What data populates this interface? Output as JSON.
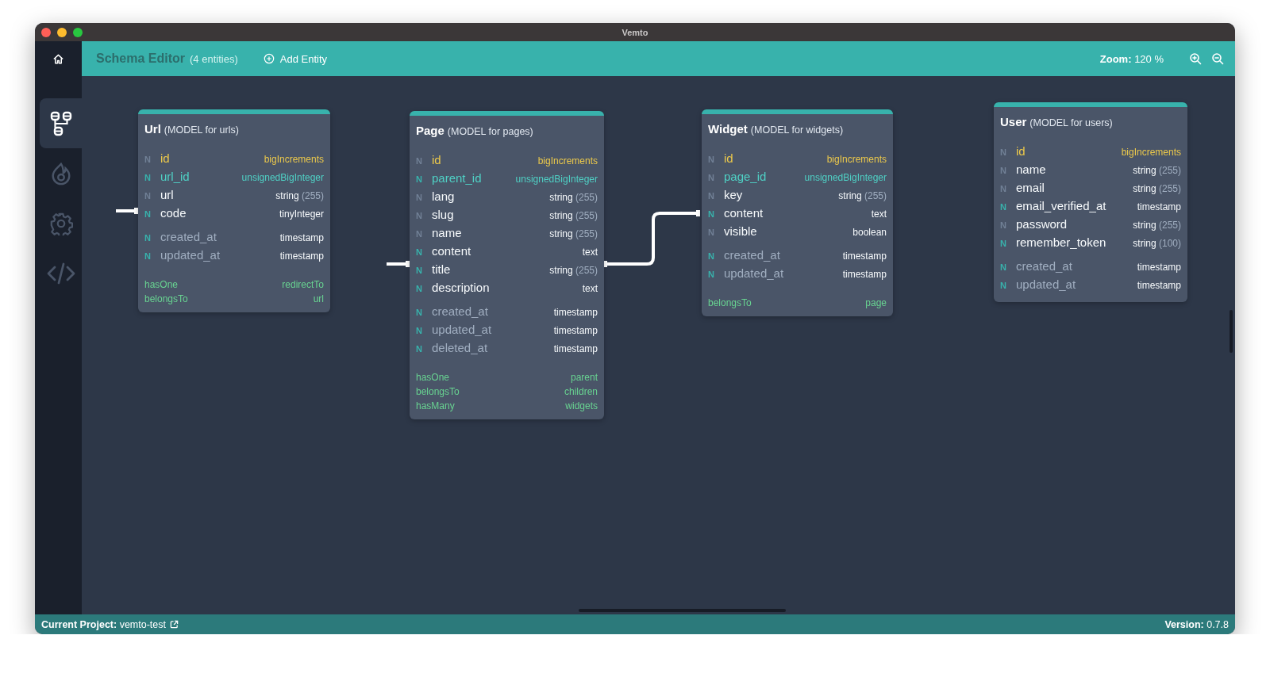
{
  "window": {
    "title": "Vemto"
  },
  "sidebar": {
    "items": [
      {
        "kind": "schema",
        "selected": true
      },
      {
        "kind": "fire",
        "selected": false
      },
      {
        "kind": "settings",
        "selected": false
      },
      {
        "kind": "code",
        "selected": false
      }
    ]
  },
  "header": {
    "title": "Schema Editor",
    "count": "(4 entities)",
    "add_button": "Add Entity",
    "zoom_label": "Zoom:",
    "zoom_value": "120 %"
  },
  "entities": [
    {
      "name": "Url",
      "subtitle": "(MODEL for urls)",
      "fields": [
        {
          "flag": "N",
          "nullable": false,
          "name": "id",
          "kind": "primary",
          "type": "bigIncrements"
        },
        {
          "flag": "N",
          "nullable": true,
          "name": "url_id",
          "kind": "foreign",
          "type": "unsignedBigInteger"
        },
        {
          "flag": "N",
          "nullable": false,
          "name": "url",
          "kind": "column",
          "type": "string",
          "length": "(255)"
        },
        {
          "flag": "N",
          "nullable": true,
          "name": "code",
          "kind": "column",
          "type": "tinyInteger"
        },
        {
          "flag": "N",
          "nullable": true,
          "name": "created_at",
          "kind": "timestamp",
          "type": "timestamp"
        },
        {
          "flag": "N",
          "nullable": true,
          "name": "updated_at",
          "kind": "timestamp",
          "type": "timestamp"
        }
      ],
      "relations": [
        {
          "type": "hasOne",
          "name": "redirectTo"
        },
        {
          "type": "belongsTo",
          "name": "url"
        }
      ]
    },
    {
      "name": "Page",
      "subtitle": "(MODEL for pages)",
      "fields": [
        {
          "flag": "N",
          "nullable": false,
          "name": "id",
          "kind": "primary",
          "type": "bigIncrements"
        },
        {
          "flag": "N",
          "nullable": true,
          "name": "parent_id",
          "kind": "foreign",
          "type": "unsignedBigInteger"
        },
        {
          "flag": "N",
          "nullable": false,
          "name": "lang",
          "kind": "column",
          "type": "string",
          "length": "(255)"
        },
        {
          "flag": "N",
          "nullable": false,
          "name": "slug",
          "kind": "column",
          "type": "string",
          "length": "(255)"
        },
        {
          "flag": "N",
          "nullable": false,
          "name": "name",
          "kind": "column",
          "type": "string",
          "length": "(255)"
        },
        {
          "flag": "N",
          "nullable": true,
          "name": "content",
          "kind": "column",
          "type": "text"
        },
        {
          "flag": "N",
          "nullable": true,
          "name": "title",
          "kind": "column",
          "type": "string",
          "length": "(255)"
        },
        {
          "flag": "N",
          "nullable": true,
          "name": "description",
          "kind": "column",
          "type": "text"
        },
        {
          "flag": "N",
          "nullable": true,
          "name": "created_at",
          "kind": "timestamp",
          "type": "timestamp"
        },
        {
          "flag": "N",
          "nullable": true,
          "name": "updated_at",
          "kind": "timestamp",
          "type": "timestamp"
        },
        {
          "flag": "N",
          "nullable": true,
          "name": "deleted_at",
          "kind": "timestamp",
          "type": "timestamp"
        }
      ],
      "relations": [
        {
          "type": "hasOne",
          "name": "parent"
        },
        {
          "type": "belongsTo",
          "name": "children"
        },
        {
          "type": "hasMany",
          "name": "widgets"
        }
      ]
    },
    {
      "name": "Widget",
      "subtitle": "(MODEL for widgets)",
      "fields": [
        {
          "flag": "N",
          "nullable": false,
          "name": "id",
          "kind": "primary",
          "type": "bigIncrements"
        },
        {
          "flag": "N",
          "nullable": false,
          "name": "page_id",
          "kind": "foreign",
          "type": "unsignedBigInteger"
        },
        {
          "flag": "N",
          "nullable": false,
          "name": "key",
          "kind": "column",
          "type": "string",
          "length": "(255)"
        },
        {
          "flag": "N",
          "nullable": true,
          "name": "content",
          "kind": "column",
          "type": "text"
        },
        {
          "flag": "N",
          "nullable": false,
          "name": "visible",
          "kind": "column",
          "type": "boolean"
        },
        {
          "flag": "N",
          "nullable": true,
          "name": "created_at",
          "kind": "timestamp",
          "type": "timestamp"
        },
        {
          "flag": "N",
          "nullable": true,
          "name": "updated_at",
          "kind": "timestamp",
          "type": "timestamp"
        }
      ],
      "relations": [
        {
          "type": "belongsTo",
          "name": "page"
        }
      ]
    },
    {
      "name": "User",
      "subtitle": "(MODEL for users)",
      "fields": [
        {
          "flag": "N",
          "nullable": false,
          "name": "id",
          "kind": "primary",
          "type": "bigIncrements"
        },
        {
          "flag": "N",
          "nullable": false,
          "name": "name",
          "kind": "column",
          "type": "string",
          "length": "(255)"
        },
        {
          "flag": "N",
          "nullable": false,
          "name": "email",
          "kind": "column",
          "type": "string",
          "length": "(255)"
        },
        {
          "flag": "N",
          "nullable": true,
          "name": "email_verified_at",
          "kind": "column",
          "type": "timestamp"
        },
        {
          "flag": "N",
          "nullable": false,
          "name": "password",
          "kind": "column",
          "type": "string",
          "length": "(255)"
        },
        {
          "flag": "N",
          "nullable": true,
          "name": "remember_token",
          "kind": "column",
          "type": "string",
          "length": "(100)"
        },
        {
          "flag": "N",
          "nullable": true,
          "name": "created_at",
          "kind": "timestamp",
          "type": "timestamp"
        },
        {
          "flag": "N",
          "nullable": true,
          "name": "updated_at",
          "kind": "timestamp",
          "type": "timestamp"
        }
      ]
    }
  ],
  "status_bar": {
    "project_label": "Current Project:",
    "project": "vemto-test",
    "version_label": "Version:",
    "version": "0.7.8"
  }
}
